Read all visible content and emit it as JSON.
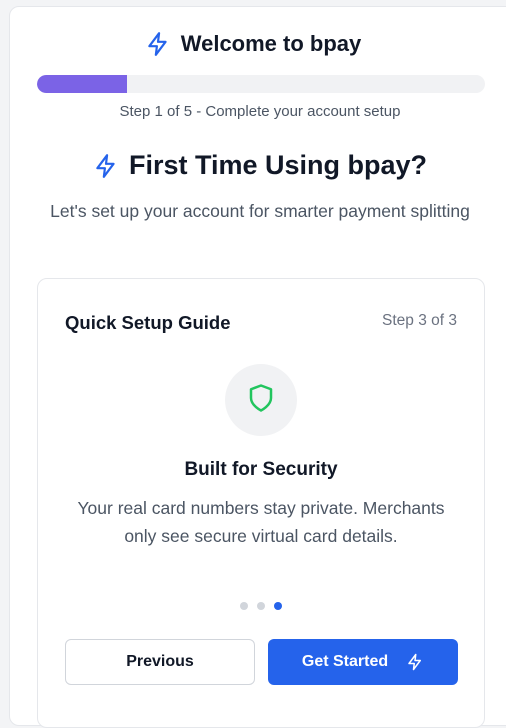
{
  "header": {
    "title": "Welcome to bpay",
    "icon": "lightning-bolt-icon",
    "accent_color": "#2563eb"
  },
  "progress": {
    "current_step": 1,
    "total_steps": 5,
    "fraction": 0.2,
    "caption": "Step 1 of 5 - Complete your account setup",
    "fill_color": "#7b63e6"
  },
  "intro": {
    "headline": "First Time Using bpay?",
    "subtitle": "Let's set up your account for smarter payment splitting"
  },
  "guide": {
    "title": "Quick Setup Guide",
    "step_label": "Step 3 of 3",
    "feature": {
      "icon": "shield-icon",
      "icon_color": "#22c55e",
      "title": "Built for Security",
      "description": "Your real card numbers stay private. Merchants only see secure virtual card details."
    },
    "dots": {
      "count": 3,
      "active_index": 2
    },
    "buttons": {
      "previous_label": "Previous",
      "start_label": "Get Started",
      "start_icon": "lightning-bolt-icon"
    }
  }
}
